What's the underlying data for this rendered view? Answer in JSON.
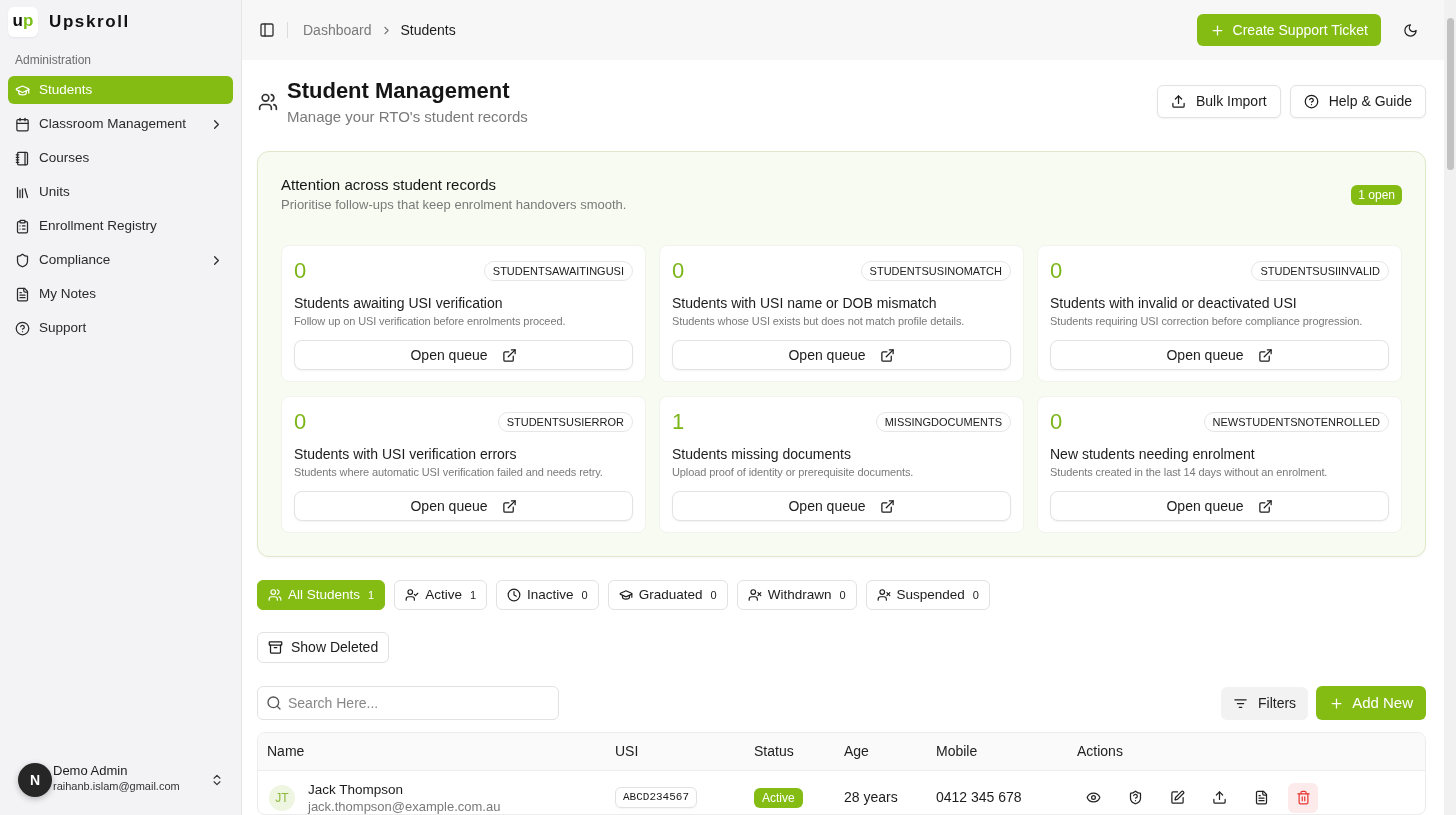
{
  "sidebar": {
    "brand": {
      "logo": "up",
      "name": "Upskroll"
    },
    "section": "Administration",
    "items": [
      {
        "label": "Students",
        "selected": true,
        "has_submenu": false
      },
      {
        "label": "Classroom Management",
        "selected": false,
        "has_submenu": true
      },
      {
        "label": "Courses",
        "selected": false,
        "has_submenu": false
      },
      {
        "label": "Units",
        "selected": false,
        "has_submenu": false
      },
      {
        "label": "Enrollment Registry",
        "selected": false,
        "has_submenu": false
      },
      {
        "label": "Compliance",
        "selected": false,
        "has_submenu": true
      },
      {
        "label": "My Notes",
        "selected": false,
        "has_submenu": false
      },
      {
        "label": "Support",
        "selected": false,
        "has_submenu": false
      }
    ],
    "user": {
      "initial": "N",
      "name": "Demo Admin",
      "email": "raihanb.islam@gmail.com"
    }
  },
  "topbar": {
    "breadcrumb": [
      {
        "label": "Dashboard",
        "current": false
      },
      {
        "label": "Students",
        "current": true
      }
    ],
    "action": "Create Support Ticket"
  },
  "header": {
    "title": "Student Management",
    "subtitle": "Manage your RTO's student records",
    "buttons": [
      "Bulk Import",
      "Help & Guide"
    ]
  },
  "attention": {
    "title": "Attention across student records",
    "subtitle": "Prioritise follow-ups that keep enrolment handovers smooth.",
    "badge": "1 open",
    "cards": [
      {
        "count": "0",
        "code": "STUDENTSAWAITINGUSI",
        "title": "Students awaiting USI verification",
        "description": "Follow up on USI verification before enrolments proceed.",
        "action": "Open queue"
      },
      {
        "count": "0",
        "code": "STUDENTSUSINOMATCH",
        "title": "Students with USI name or DOB mismatch",
        "description": "Students whose USI exists but does not match profile details.",
        "action": "Open queue"
      },
      {
        "count": "0",
        "code": "STUDENTSUSIINVALID",
        "title": "Students with invalid or deactivated USI",
        "description": "Students requiring USI correction before compliance progression.",
        "action": "Open queue"
      },
      {
        "count": "0",
        "code": "STUDENTSUSIERROR",
        "title": "Students with USI verification errors",
        "description": "Students where automatic USI verification failed and needs retry.",
        "action": "Open queue"
      },
      {
        "count": "1",
        "code": "MISSINGDOCUMENTS",
        "title": "Students missing documents",
        "description": "Upload proof of identity or prerequisite documents.",
        "action": "Open queue"
      },
      {
        "count": "0",
        "code": "NEWSTUDENTSNOTENROLLED",
        "title": "New students needing enrolment",
        "description": "Students created in the last 14 days without an enrolment.",
        "action": "Open queue"
      }
    ]
  },
  "status_tabs": [
    {
      "label": "All Students",
      "count": "1",
      "selected": true
    },
    {
      "label": "Active",
      "count": "1",
      "selected": false
    },
    {
      "label": "Inactive",
      "count": "0",
      "selected": false
    },
    {
      "label": "Graduated",
      "count": "0",
      "selected": false
    },
    {
      "label": "Withdrawn",
      "count": "0",
      "selected": false
    },
    {
      "label": "Suspended",
      "count": "0",
      "selected": false
    }
  ],
  "show_deleted": "Show Deleted",
  "search": {
    "placeholder": "Search Here..."
  },
  "toolbar": {
    "filters": "Filters",
    "add": "Add New"
  },
  "table": {
    "columns": [
      "Name",
      "USI",
      "Status",
      "Age",
      "Mobile",
      "Actions"
    ],
    "rows": [
      {
        "initials": "JT",
        "name": "Jack Thompson",
        "email": "jack.thompson@example.com.au",
        "usi": "ABCD234567",
        "status": "Active",
        "age": "28 years",
        "mobile": "0412 345 678"
      }
    ]
  }
}
